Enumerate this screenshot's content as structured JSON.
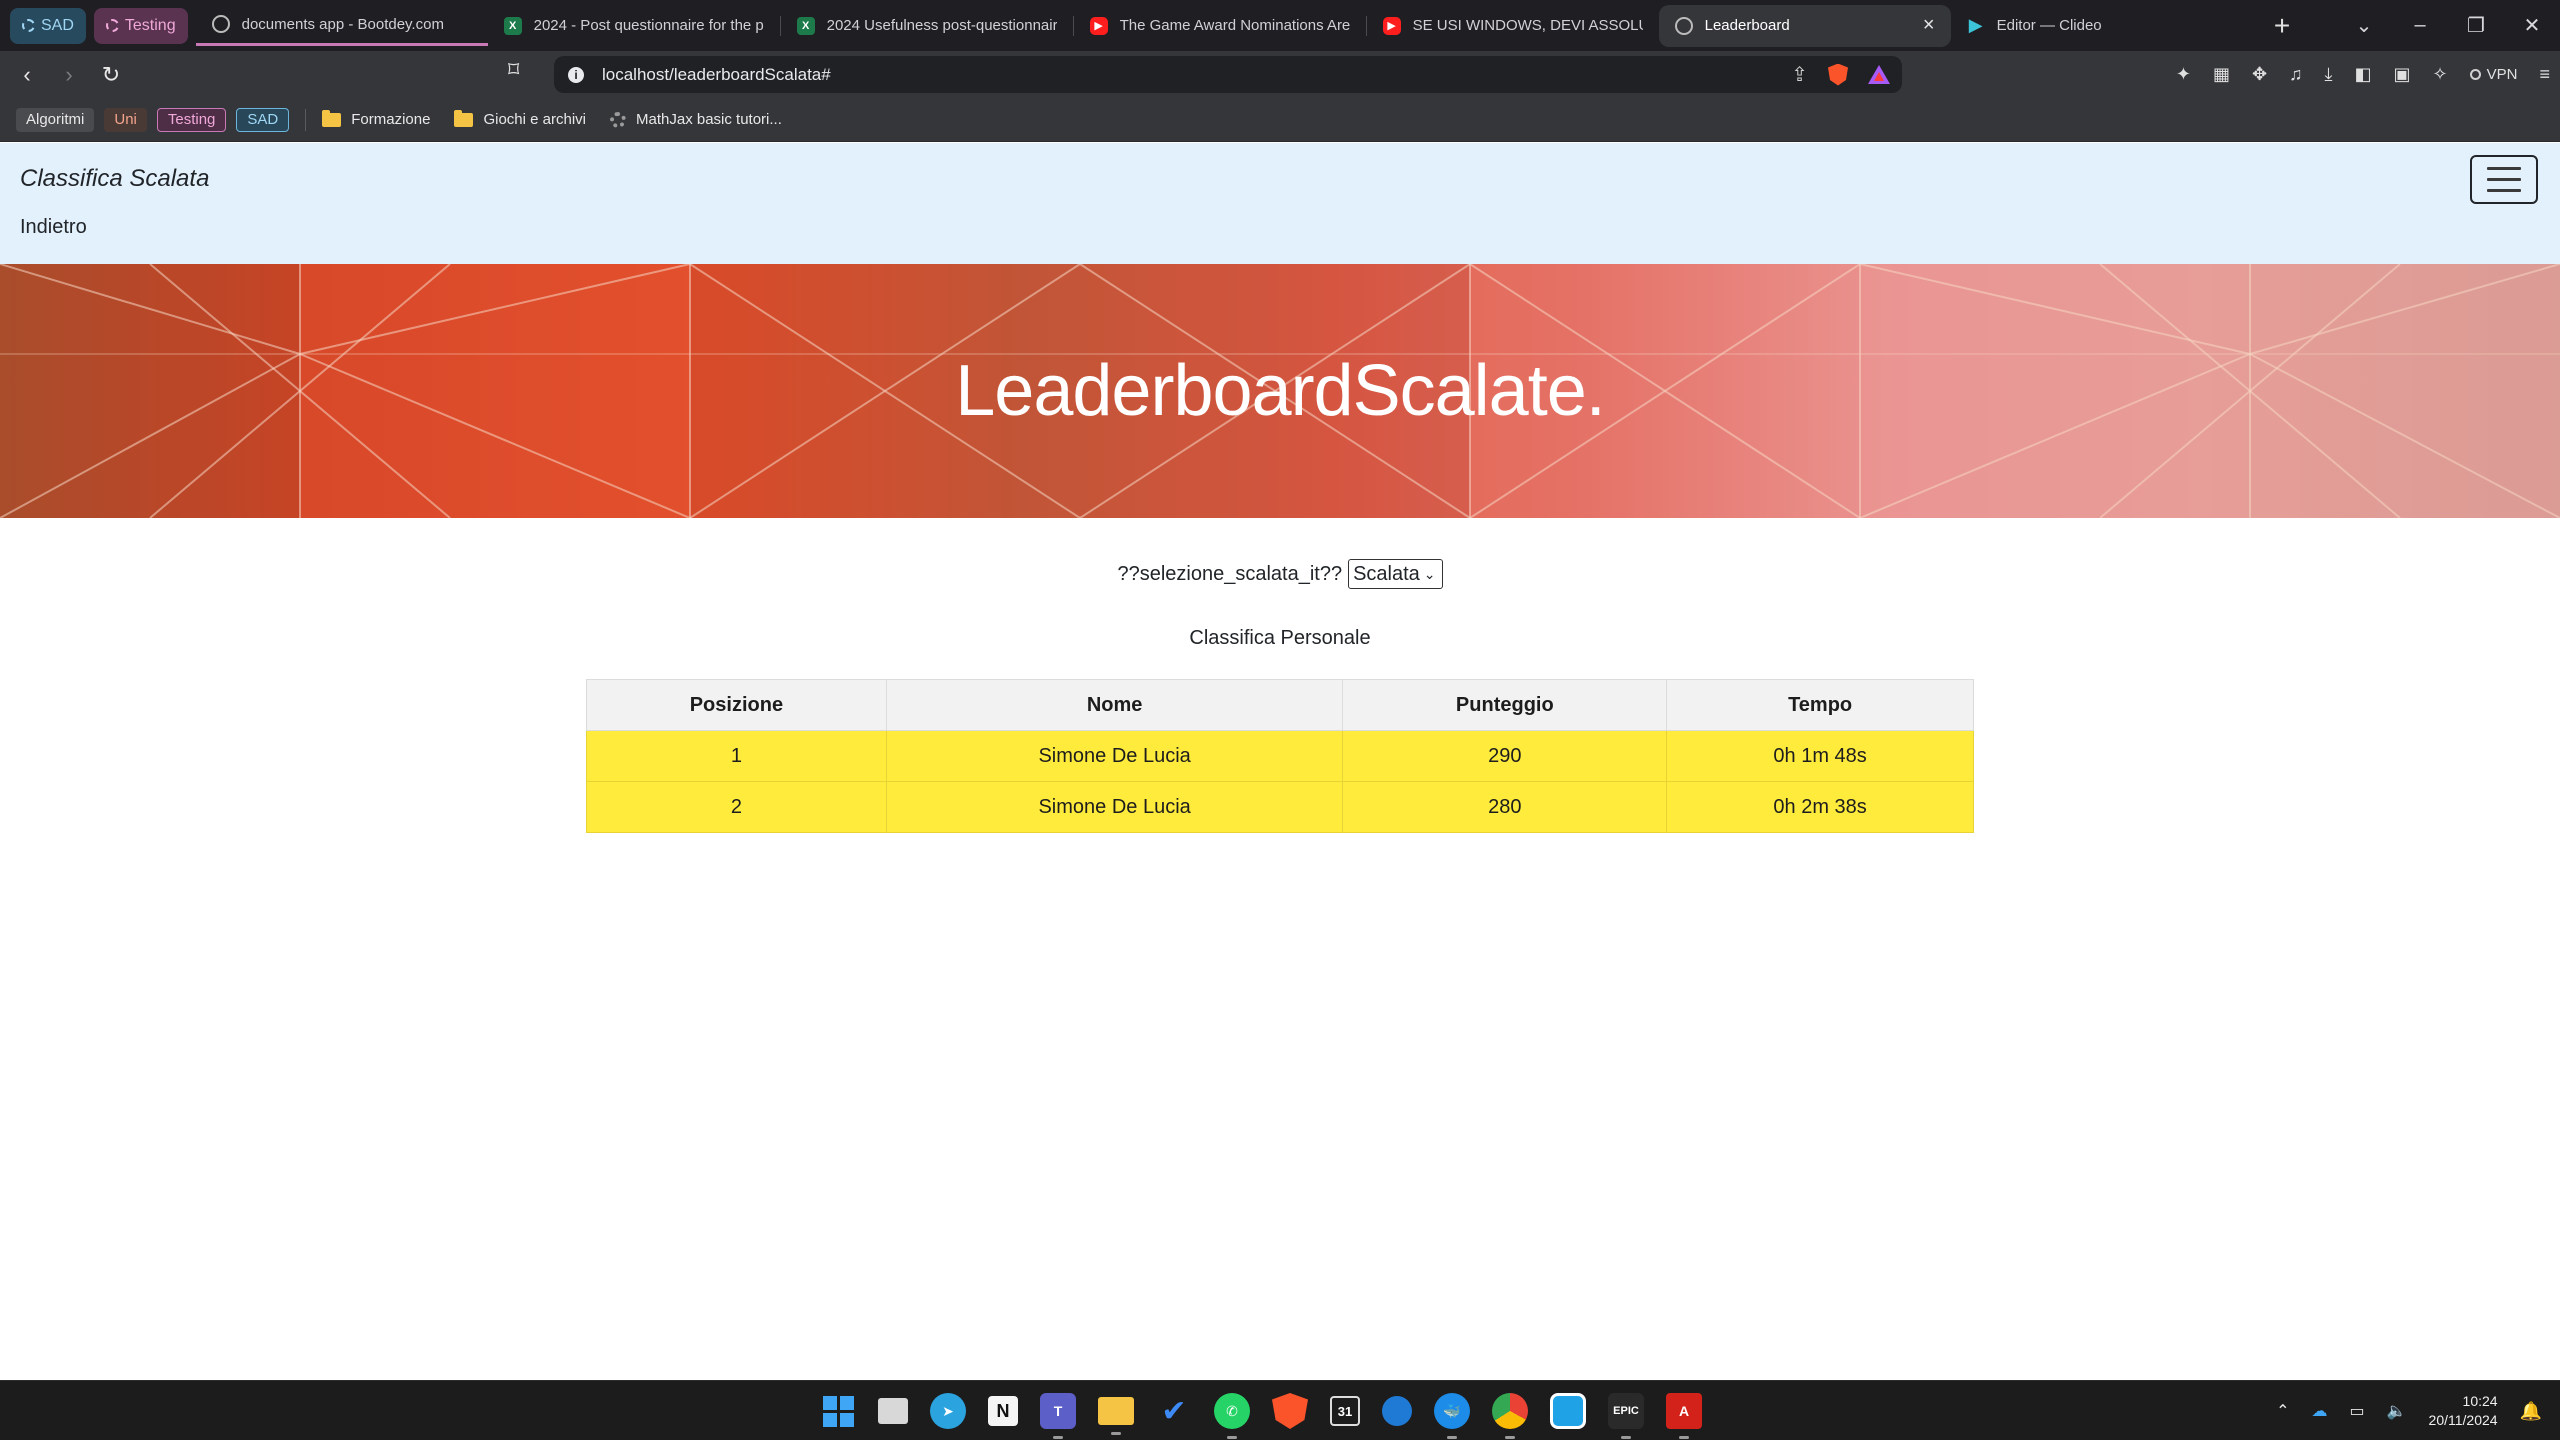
{
  "browser": {
    "tab_groups": [
      {
        "label": "SAD"
      },
      {
        "label": "Testing"
      }
    ],
    "tabs": [
      {
        "title": "documents app - Bootdey.com",
        "icon": "globe-icon"
      },
      {
        "title": "2024 - Post questionnaire for the p",
        "icon": "excel-icon"
      },
      {
        "title": "2024 Usefulness post-questionnair",
        "icon": "excel-icon"
      },
      {
        "title": "The Game Award Nominations Are",
        "icon": "youtube-icon"
      },
      {
        "title": "SE USI WINDOWS, DEVI ASSOLUTA",
        "icon": "youtube-icon"
      },
      {
        "title": "Leaderboard",
        "icon": "globe-icon",
        "active": true
      },
      {
        "title": "Editor — Clideo",
        "icon": "clideo-icon"
      }
    ],
    "address": "localhost/leaderboardScalata#",
    "vpn_label": "VPN",
    "bookmarks": {
      "groups": [
        "Algoritmi",
        "Uni",
        "Testing",
        "SAD"
      ],
      "folders": [
        "Formazione",
        "Giochi e archivi"
      ],
      "links": [
        "MathJax basic tutori..."
      ]
    }
  },
  "page": {
    "brand": "Classifica Scalata",
    "back_link": "Indietro",
    "hero_title": "LeaderboardScalate.",
    "selector_label": "??selezione_scalata_it??",
    "selector_value": "Scalata",
    "caption": "Classifica Personale",
    "table": {
      "headers": [
        "Posizione",
        "Nome",
        "Punteggio",
        "Tempo"
      ],
      "rows": [
        [
          "1",
          "Simone De Lucia",
          "290",
          "0h 1m 48s"
        ],
        [
          "2",
          "Simone De Lucia",
          "280",
          "0h 2m 38s"
        ]
      ],
      "row_highlight_color": "#ffeb3b"
    }
  },
  "taskbar": {
    "time": "10:24",
    "date": "20/11/2024",
    "apps": [
      "windows-start-icon",
      "task-view-icon",
      "telegram-icon",
      "notion-icon",
      "teams-icon",
      "file-explorer-icon",
      "todo-icon",
      "whatsapp-icon",
      "brave-icon",
      "calendar-icon",
      "edge-icon",
      "docker-icon",
      "chrome-icon",
      "app-icon",
      "epic-games-icon",
      "acrobat-icon"
    ],
    "calendar_day": "31",
    "epic_label": "EPIC"
  }
}
